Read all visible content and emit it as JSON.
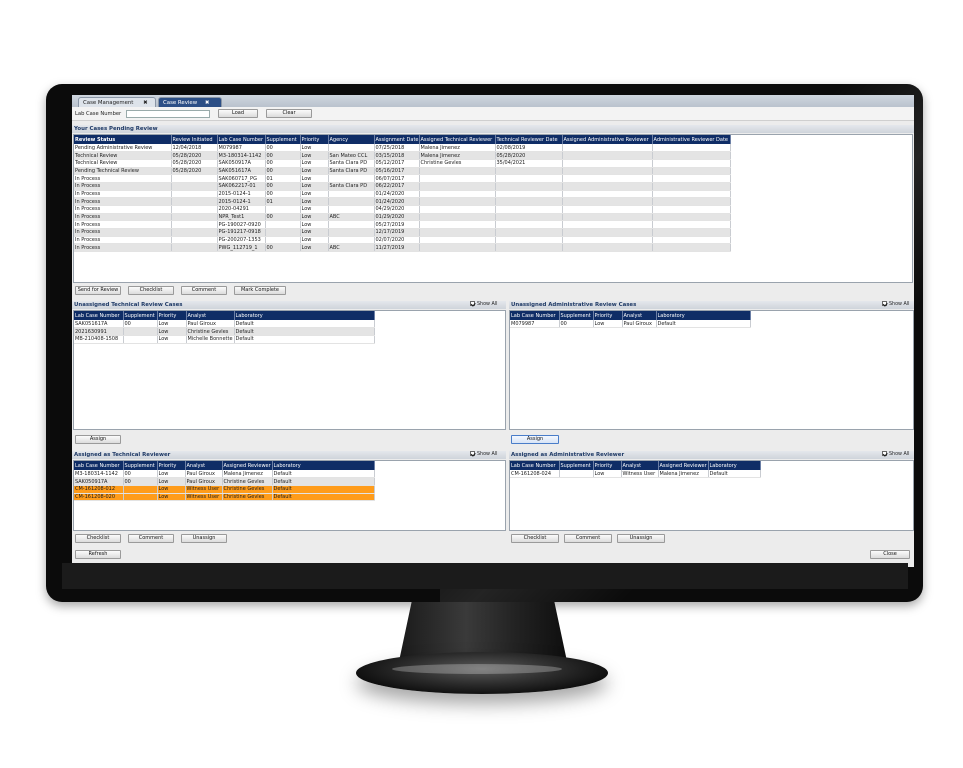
{
  "tabs": [
    {
      "label": "Case Management",
      "close": "✖"
    },
    {
      "label": "Case Review",
      "close": "✖"
    }
  ],
  "toolbar": {
    "lab_case_label": "Lab Case Number",
    "lab_case_value": "",
    "load_label": "Load",
    "clear_label": "Clear"
  },
  "pending": {
    "title": "Your Cases Pending Review",
    "columns": [
      "Review Status",
      "Review Initiated",
      "Lab Case Number",
      "Supplement",
      "Priority",
      "Agency",
      "Assignment Date",
      "Assigned Technical Reviewer",
      "Technical Reviewer Date",
      "Assigned Administrative Reviewer",
      "Administrative Reviewer Date"
    ],
    "rows": [
      [
        "Pending Administrative Review",
        "12/04/2018",
        "M079987",
        "00",
        "Low",
        "",
        "07/25/2018",
        "Malena Jimenez",
        "02/08/2019",
        "",
        ""
      ],
      [
        "Technical Review",
        "05/28/2020",
        "M3-180314-1142",
        "00",
        "Low",
        "San Mateo CCL",
        "03/15/2018",
        "Malena Jimenez",
        "05/28/2020",
        "",
        ""
      ],
      [
        "Technical Review",
        "05/28/2020",
        "SAK050917A",
        "00",
        "Low",
        "Santa Clara PD",
        "05/12/2017",
        "Christine Gevles",
        "35/04/2021",
        "",
        ""
      ],
      [
        "Pending Technical Review",
        "05/28/2020",
        "SAK051617A",
        "00",
        "Low",
        "Santa Clara PD",
        "05/16/2017",
        "",
        "",
        "",
        ""
      ],
      [
        "In Process",
        "",
        "SAK060717_PG",
        "01",
        "Low",
        "",
        "06/07/2017",
        "",
        "",
        "",
        ""
      ],
      [
        "In Process",
        "",
        "SAK062217-01",
        "00",
        "Low",
        "Santa Clara PD",
        "06/22/2017",
        "",
        "",
        "",
        ""
      ],
      [
        "In Process",
        "",
        "2015-0124-1",
        "00",
        "Low",
        "",
        "01/24/2020",
        "",
        "",
        "",
        ""
      ],
      [
        "In Process",
        "",
        "2015-0124-1",
        "01",
        "Low",
        "",
        "01/24/2020",
        "",
        "",
        "",
        ""
      ],
      [
        "In Process",
        "",
        "2020-04291",
        "",
        "Low",
        "",
        "04/29/2020",
        "",
        "",
        "",
        ""
      ],
      [
        "In Process",
        "",
        "NPR_Test1",
        "00",
        "Low",
        "ABC",
        "01/29/2020",
        "",
        "",
        "",
        ""
      ],
      [
        "In Process",
        "",
        "PG-190027-0920",
        "",
        "Low",
        "",
        "05/27/2019",
        "",
        "",
        "",
        ""
      ],
      [
        "In Process",
        "",
        "PG-191217-0918",
        "",
        "Low",
        "",
        "12/17/2019",
        "",
        "",
        "",
        ""
      ],
      [
        "In Process",
        "",
        "PG-200207-1353",
        "",
        "Low",
        "",
        "02/07/2020",
        "",
        "",
        "",
        ""
      ],
      [
        "In Process",
        "",
        "PWG_112719_1",
        "00",
        "Low",
        "ABC",
        "11/27/2019",
        "",
        "",
        "",
        ""
      ]
    ],
    "buttons": [
      "Send for Review",
      "Checklist",
      "Comment",
      "Mark Complete"
    ]
  },
  "unassigned_tech": {
    "title": "Unassigned Technical Review Cases",
    "show_all": "Show All",
    "columns": [
      "Lab Case Number",
      "Supplement",
      "Priority",
      "Analyst",
      "Laboratory"
    ],
    "rows": [
      [
        "SAK051617A",
        "00",
        "Low",
        "Paul Giroux",
        "Default"
      ],
      [
        "2021630991",
        "",
        "Low",
        "Christine Gevles",
        "Default"
      ],
      [
        "MB-210408-1508",
        "",
        "Low",
        "Michelle Bonnette",
        "Default"
      ]
    ],
    "assign_label": "Assign"
  },
  "unassigned_admin": {
    "title": "Unassigned Administrative Review Cases",
    "show_all": "Show All",
    "columns": [
      "Lab Case Number",
      "Supplement",
      "Priority",
      "Analyst",
      "Laboratory"
    ],
    "rows": [
      [
        "M079987",
        "00",
        "Low",
        "Paul Giroux",
        "Default"
      ]
    ],
    "assign_label": "Assign"
  },
  "assigned_tech": {
    "title": "Assigned as Technical Reviewer",
    "show_all": "Show All",
    "columns": [
      "Lab Case Number",
      "Supplement",
      "Priority",
      "Analyst",
      "Assigned Reviewer",
      "Laboratory"
    ],
    "rows": [
      [
        "M3-180314-1142",
        "00",
        "Low",
        "Paul Giroux",
        "Malena Jimenez",
        "Default"
      ],
      [
        "SAK050917A",
        "00",
        "Low",
        "Paul Giroux",
        "Christine Gevles",
        "Default"
      ],
      [
        "CM-161208-012",
        "",
        "Low",
        "Witness User",
        "Christine Gevles",
        "Default"
      ],
      [
        "CM-161208-020",
        "",
        "Low",
        "Witness User",
        "Christine Gevles",
        "Default"
      ]
    ],
    "buttons": [
      "Checklist",
      "Comment",
      "Unassign"
    ]
  },
  "assigned_admin": {
    "title": "Assigned as Administrative Reviewer",
    "show_all": "Show All",
    "columns": [
      "Lab Case Number",
      "Supplement",
      "Priority",
      "Analyst",
      "Assigned Reviewer",
      "Laboratory"
    ],
    "rows": [
      [
        "CM-161208-024",
        "",
        "Low",
        "Witness User",
        "Malena Jimenez",
        "Default"
      ]
    ],
    "buttons": [
      "Checklist",
      "Comment",
      "Unassign"
    ]
  },
  "footer": {
    "refresh_label": "Refresh",
    "close_label": "Close"
  },
  "colors": {
    "header_navy": "#0f2d66",
    "highlight_orange": "#ff9c1a",
    "active_tab": "#2c4f86"
  }
}
